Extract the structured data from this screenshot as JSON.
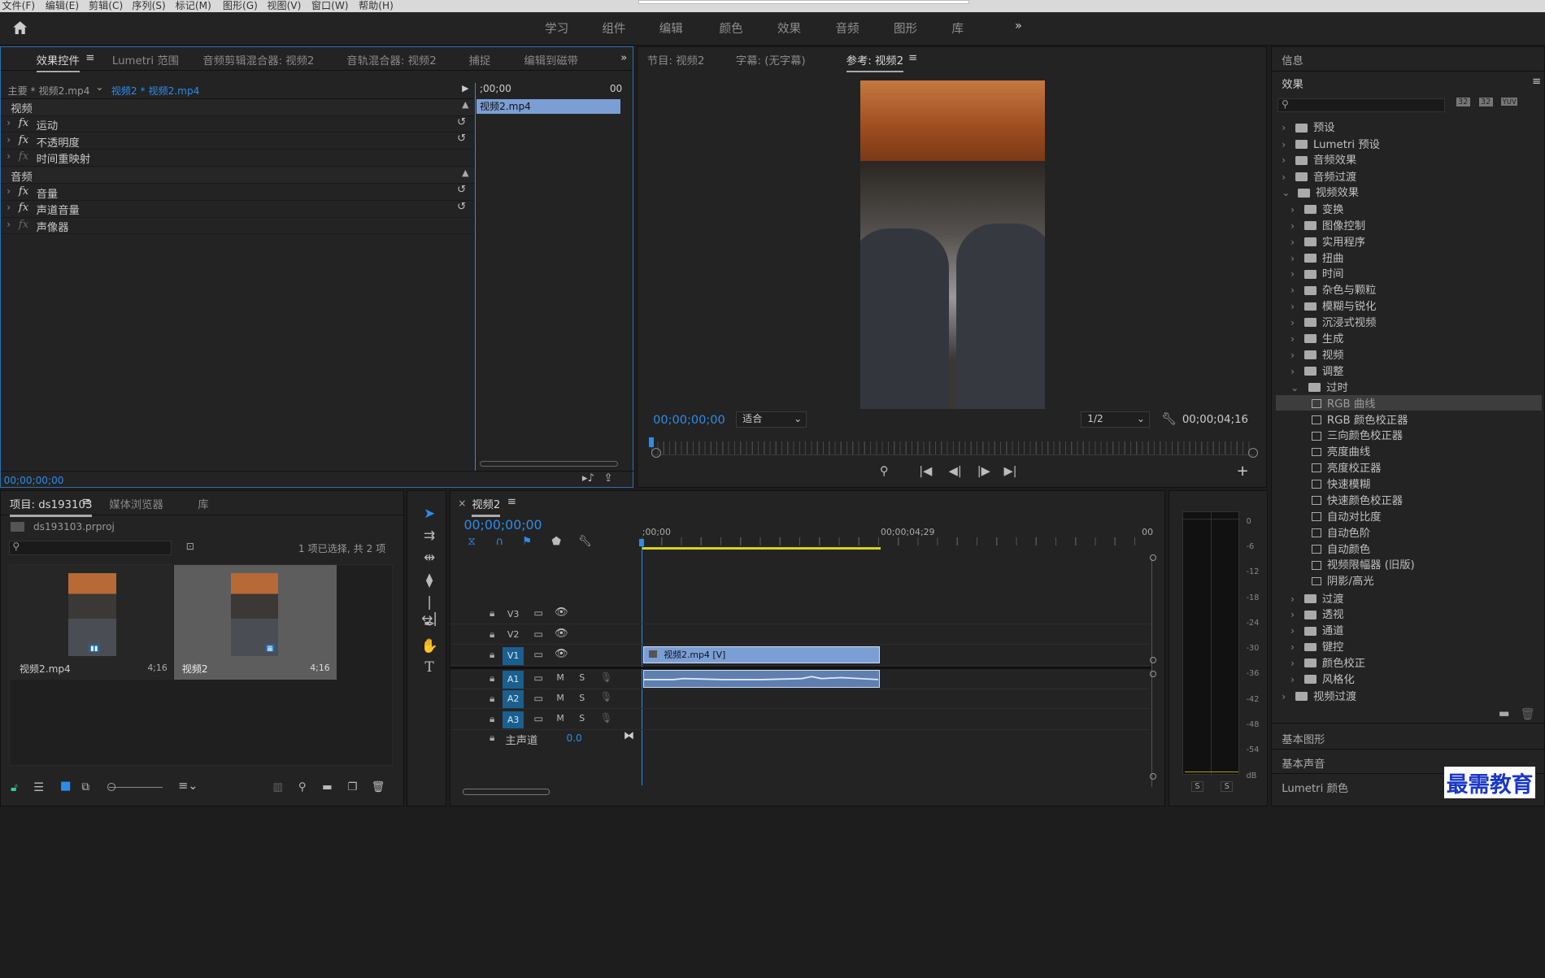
{
  "menu": [
    "文件(F)",
    "编辑(E)",
    "剪辑(C)",
    "序列(S)",
    "标记(M)",
    "图形(G)",
    "视图(V)",
    "窗口(W)",
    "帮助(H)"
  ],
  "workspaces": [
    "学习",
    "组件",
    "编辑",
    "颜色",
    "效果",
    "音频",
    "图形",
    "库"
  ],
  "effect_controls": {
    "tabs": [
      "效果控件",
      "Lumetri 范围",
      "音频剪辑混合器: 视频2",
      "音轨混合器: 视频2",
      "捕捉",
      "编辑到磁带"
    ],
    "master": "主要 * 视频2.mp4",
    "sequence": "视频2 * 视频2.mp4",
    "time_start": ";00;00",
    "time_end": "00",
    "clip": "视频2.mp4",
    "section_video": "视频",
    "section_audio": "音频",
    "video_effects": [
      "运动",
      "不透明度",
      "时间重映射"
    ],
    "audio_effects": [
      "音量",
      "声道音量",
      "声像器"
    ],
    "timecode": "00;00;00;00",
    "fx": "fx"
  },
  "program": {
    "tabs": [
      "节目: 视频2",
      "字幕: (无字幕)",
      "参考: 视频2"
    ],
    "timecode": "00;00;00;00",
    "fit": "适合",
    "quality": "1/2",
    "duration": "00;00;04;16"
  },
  "effects_panel": {
    "info_title": "信息",
    "title": "效果",
    "icons": [
      "32",
      "32",
      "YUV"
    ],
    "top": [
      "预设",
      "Lumetri 预设",
      "音频效果",
      "音频过渡",
      "视频效果"
    ],
    "video_effect_folders": [
      "变换",
      "图像控制",
      "实用程序",
      "扭曲",
      "时间",
      "杂色与颗粒",
      "模糊与锐化",
      "沉浸式视频",
      "生成",
      "视频",
      "调整",
      "过时"
    ],
    "obsolete": [
      "RGB 曲线",
      "RGB 颜色校正器",
      "三向颜色校正器",
      "亮度曲线",
      "亮度校正器",
      "快速模糊",
      "快速颜色校正器",
      "自动对比度",
      "自动色阶",
      "自动颜色",
      "视频限幅器 (旧版)",
      "阴影/高光"
    ],
    "after": [
      "过渡",
      "透视",
      "通道",
      "键控",
      "颜色校正",
      "风格化"
    ],
    "last": "视频过渡",
    "basic_graphics": "基本图形",
    "basic_sound": "基本声音",
    "lumetri_color": "Lumetri 颜色"
  },
  "project": {
    "tabs": [
      "项目: ds193103",
      "媒体浏览器",
      "库"
    ],
    "file": "ds193103.prproj",
    "selection": "1 项已选择, 共 2 项",
    "items": [
      {
        "name": "视频2.mp4",
        "duration": "4;16"
      },
      {
        "name": "视频2",
        "duration": "4;16"
      }
    ]
  },
  "timeline": {
    "title": "视频2",
    "timecode": "00;00;00;00",
    "ruler": [
      ";00;00",
      "00;00;04;29",
      "00"
    ],
    "video_tracks": [
      "V3",
      "V2",
      "V1"
    ],
    "audio_tracks": [
      "A1",
      "A2",
      "A3"
    ],
    "master": "主声道",
    "master_value": "0.0",
    "clip_video": "视频2.mp4 [V]",
    "m": "M",
    "s": "S"
  },
  "meter": {
    "scale": [
      "0",
      "-6",
      "-12",
      "-18",
      "-24",
      "-30",
      "-36",
      "-42",
      "-48",
      "-54",
      "dB"
    ],
    "s1": "S",
    "s2": "S"
  },
  "watermark": "最需教育",
  "colors": {
    "accent": "#2d8ceb",
    "clip": "#7b9fd4",
    "selected_track": "#1b5f8f"
  }
}
